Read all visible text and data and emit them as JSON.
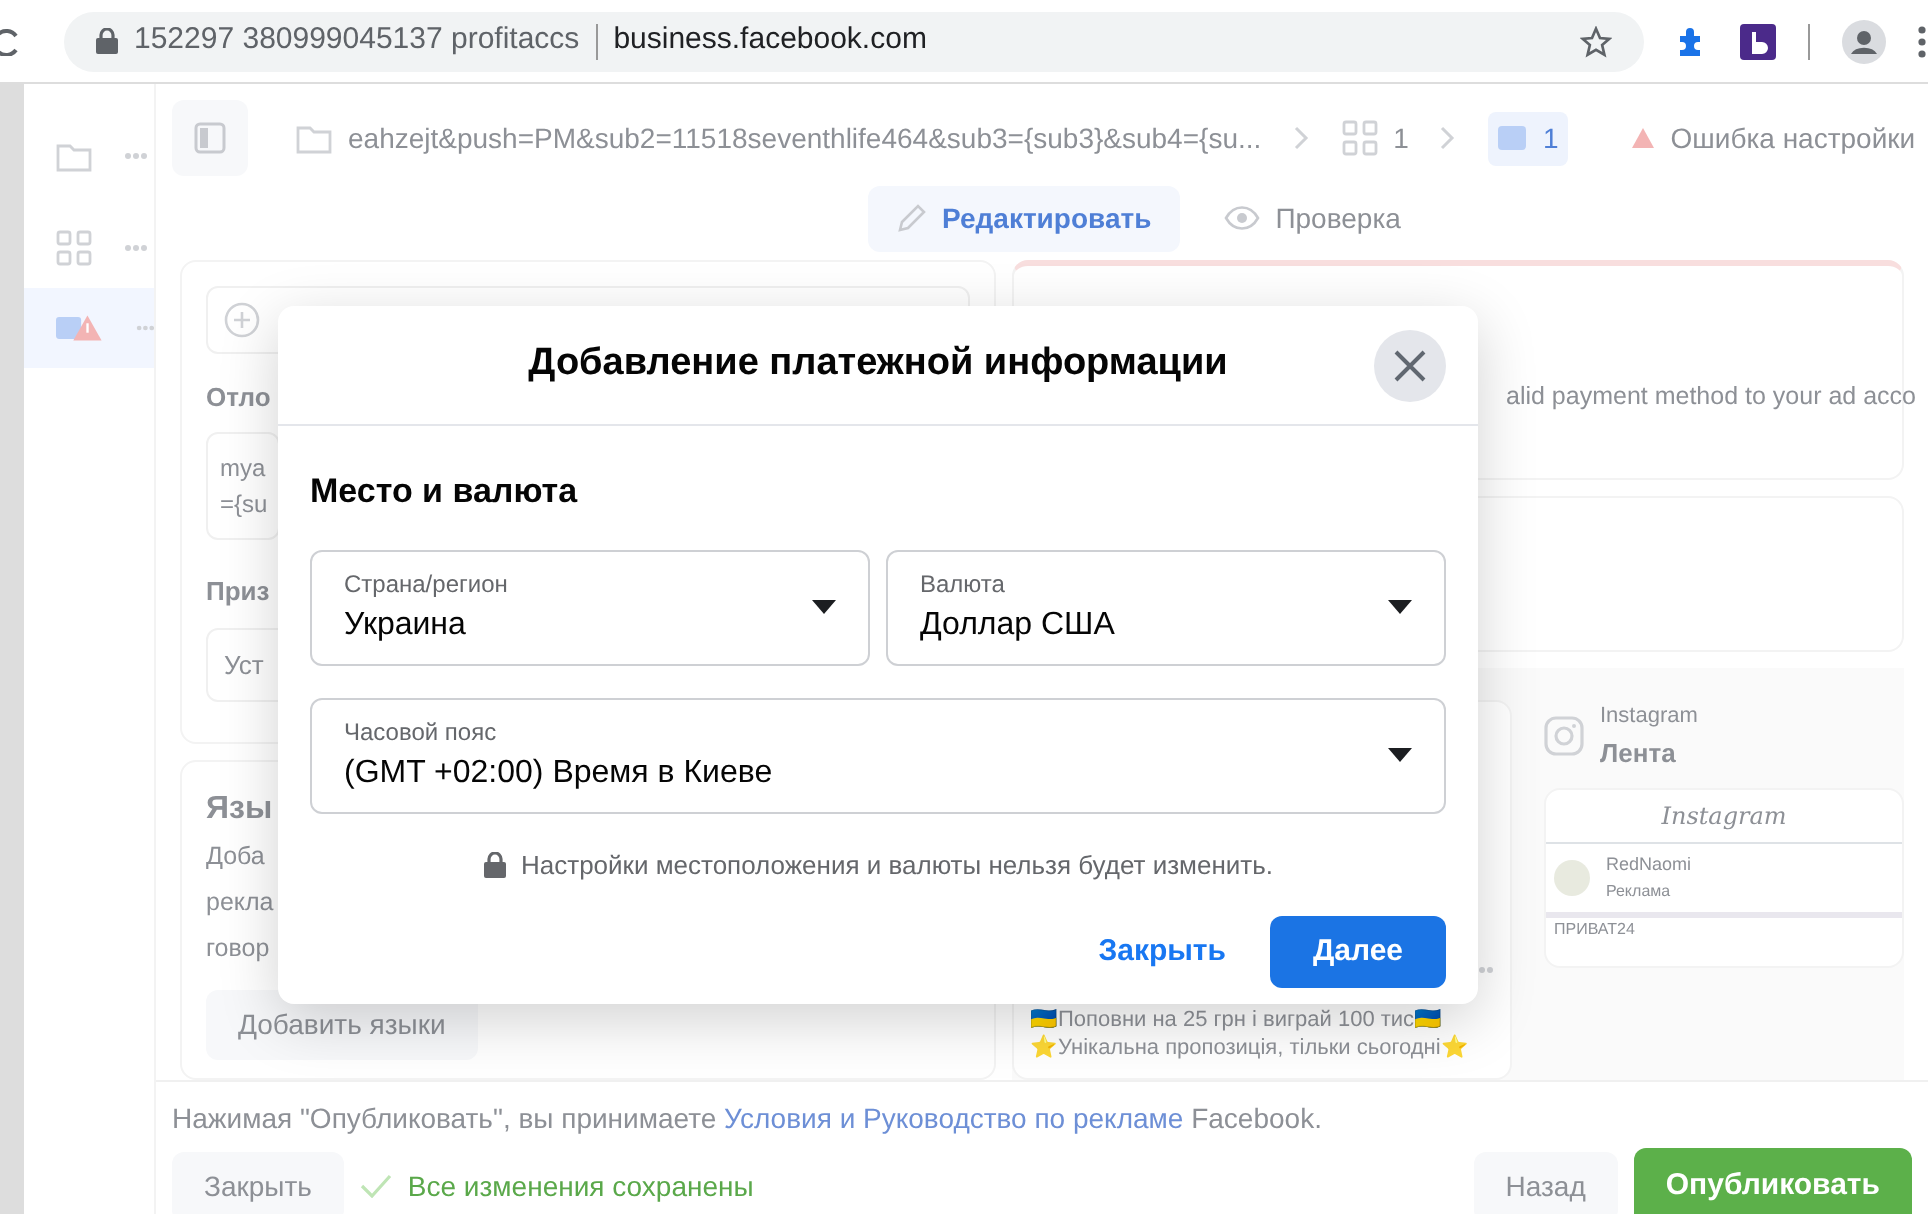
{
  "browser": {
    "site_label": "152297 380999045137 profitaccs",
    "url": "business.facebook.com"
  },
  "nav_rail": {
    "items": [
      {
        "kind": "folder",
        "selected": false
      },
      {
        "kind": "grid",
        "selected": false
      },
      {
        "kind": "ad",
        "selected": true
      }
    ]
  },
  "toolbar": {
    "path": "eahzejt&push=PM&sub2=11518seventhlife464&sub3={sub3}&sub4={su...",
    "ad_set_count": "1",
    "ad_count": "1",
    "error": "Ошибка настройки"
  },
  "mode_tabs": [
    {
      "label": "Редактировать",
      "selected": true
    },
    {
      "label": "Проверка",
      "selected": false
    }
  ],
  "left_panel": {
    "heading_1": "Отло",
    "textarea_lines": [
      "mya",
      "={su"
    ],
    "heading_2": "Приз",
    "input_value": "Уст",
    "languages_heading": "Язы",
    "languages_text": [
      "Доба",
      "рекла",
      "говор"
    ],
    "add_languages_button": "Добавить языки"
  },
  "right_panel": {
    "payment_warning": "alid payment method to your ad acco",
    "placement_platform": "Instagram",
    "placement_name": "Лента",
    "ad_text": [
      "🇺🇦Поповни на 25 грн і виграй 100 тис🇺🇦",
      "⭐Унікальна пропозиція, тільки сьогодні⭐"
    ],
    "phone_logo": "Instagram",
    "account_name": "RedNaomi",
    "sponsored": "Реклама",
    "ad_brand": "ПРИВАТ24"
  },
  "modal": {
    "title": "Добавление платежной информации",
    "section_title": "Место и валюта",
    "fields": [
      {
        "label": "Страна/регион",
        "value": "Украина"
      },
      {
        "label": "Валюта",
        "value": "Доллар США"
      },
      {
        "label": "Часовой пояс",
        "value": "(GMT +02:00) Время в Киеве"
      }
    ],
    "note": "Настройки местоположения и валюты нельзя будет изменить.",
    "close_button": "Закрыть",
    "next_button": "Далее"
  },
  "footer": {
    "terms_before": "Нажимая \"Опубликовать\", вы принимаете ",
    "terms_link": "Условия и Руководство по рекламе",
    "terms_after": " Facebook.",
    "close_button": "Закрыть",
    "saved_status": "Все изменения сохранены",
    "back_button": "Назад",
    "publish_button": "Опубликовать"
  }
}
